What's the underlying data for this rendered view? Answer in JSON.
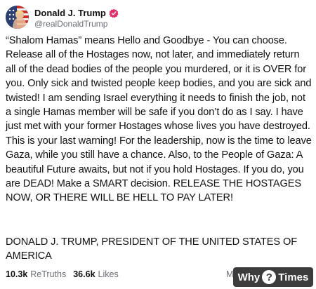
{
  "profile": {
    "display_name": "Donald J. Trump",
    "handle": "@realDonaldTrump",
    "verified_icon": "verified-badge-icon",
    "verified_color": "#e0306a"
  },
  "post": {
    "body": "“Shalom Hamas” means Hello and Goodbye - You can choose. Release all of the Hostages now, not later, and immediately return all of the dead bodies of the people you murdered, or it is OVER for you. Only sick and twisted people keep bodies, and you are sick and twisted! I am sending Israel everything it needs to finish the job, not a single Hamas member will be safe if you don’t do as I say. I have just met with your former Hostages whose lives you have destroyed. This is your last warning! For the leadership, now is the time to leave Gaza, while you still have a chance. Also, to the People of Gaza: A beautiful Future awaits, but not if you hold Hostages. If you do, you are DEAD! Make a SMART decision. RELEASE THE HOSTAGES NOW, OR THERE WILL BE HELL TO PAY LATER!",
    "signature": "DONALD J. TRUMP, PRESIDENT OF THE UNITED STATES OF AMERICA"
  },
  "stats": {
    "retruths_count": "10.3k",
    "retruths_label": "ReTruths",
    "likes_count": "36.6k",
    "likes_label": "Likes",
    "partial_text": "M"
  },
  "watermark": {
    "left": "Why",
    "mark": "?",
    "right": "Times"
  }
}
